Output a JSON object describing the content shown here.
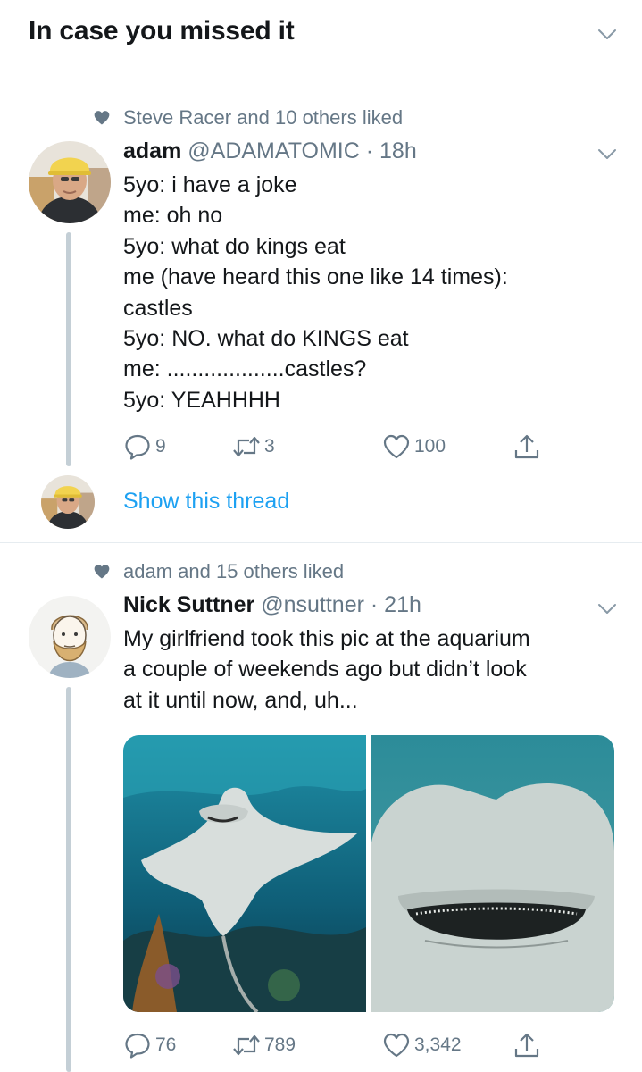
{
  "header": {
    "title": "In case you missed it"
  },
  "tweets": [
    {
      "social_context": "Steve Racer and 10 others liked",
      "name": "adam",
      "handle": "@ADAMATOMIC",
      "separator": "·",
      "time": "18h",
      "lines": [
        "5yo: i have a joke",
        "me: oh no",
        "5yo: what do kings eat",
        "me (have heard this one like 14 times):",
        "castles",
        "5yo: NO. what do KINGS eat",
        "me: ...................castles?",
        "5yo: YEAHHHH"
      ],
      "replies": "9",
      "retweets": "3",
      "likes": "100",
      "show_thread": "Show this thread"
    },
    {
      "social_context": "adam and 15 others liked",
      "name": "Nick Suttner",
      "handle": "@nsuttner",
      "separator": "·",
      "time": "21h",
      "lines": [
        "My girlfriend took this pic at the aquarium",
        "a couple of weekends ago but didn’t look",
        "at it until now, and, uh..."
      ],
      "replies": "76",
      "retweets": "789",
      "likes": "3,342"
    }
  ],
  "icons": {
    "chevron": "chevron-down-icon",
    "heart": "heart-icon",
    "reply": "reply-icon",
    "retweet": "retweet-icon",
    "like": "like-icon",
    "share": "share-icon"
  },
  "colors": {
    "accent": "#1da1f2",
    "secondary_text": "#657786",
    "primary_text": "#14171a",
    "divider": "#e6ecf0",
    "thread_line": "#c4cfd6"
  }
}
